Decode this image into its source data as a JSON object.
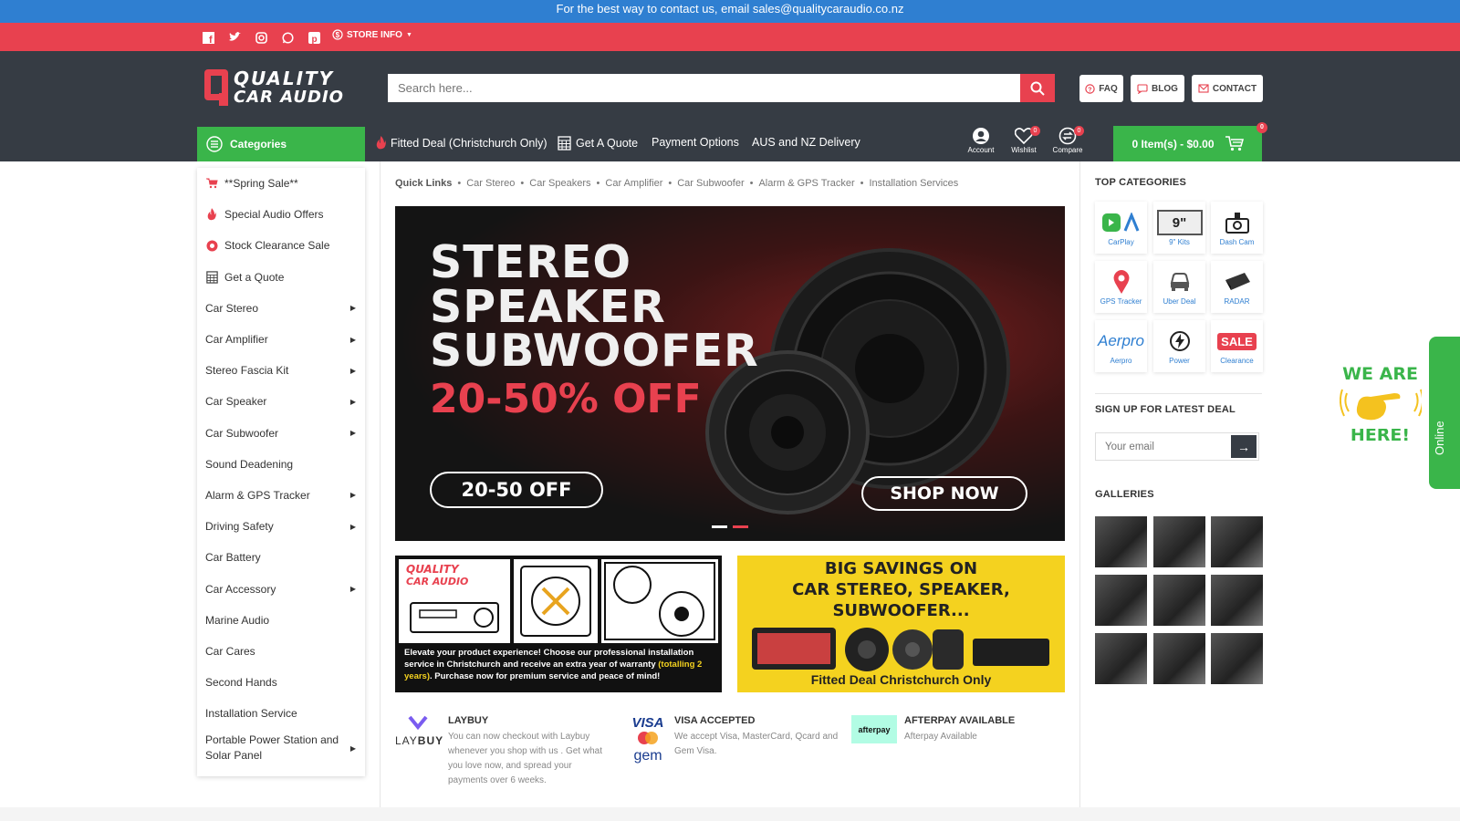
{
  "top_bar": {
    "message": "For the best way to contact us, email sales@qualitycaraudio.co.nz"
  },
  "social": {
    "icons": [
      "facebook-icon",
      "twitter-icon",
      "instagram-icon",
      "whatsapp-icon",
      "pinterest-icon"
    ],
    "store_info": "STORE INFO"
  },
  "header": {
    "logo_line1": "QUALITY",
    "logo_line2": "CAR AUDIO",
    "search_placeholder": "Search here...",
    "buttons": {
      "faq": "FAQ",
      "blog": "BLOG",
      "contact": "CONTACT"
    }
  },
  "nav": {
    "categories_label": "Categories",
    "links": [
      "Fitted Deal (Christchurch Only)",
      "Get A Quote",
      "Payment Options",
      "AUS and NZ Delivery"
    ],
    "account": "Account",
    "wishlist": "Wishlist",
    "wishlist_count": "0",
    "compare": "Compare",
    "compare_count": "0",
    "cart": "0 Item(s) - $0.00",
    "cart_count": "0"
  },
  "sidebar": {
    "items": [
      {
        "label": "**Spring Sale**",
        "icon": "cart-icon",
        "arrow": false
      },
      {
        "label": "Special Audio Offers",
        "icon": "flame-icon",
        "arrow": false
      },
      {
        "label": "Stock Clearance Sale",
        "icon": "clearance-icon",
        "arrow": false
      },
      {
        "label": "Get a Quote",
        "icon": "calculator-icon",
        "arrow": false
      },
      {
        "label": "Car Stereo",
        "arrow": true
      },
      {
        "label": "Car Amplifier",
        "arrow": true
      },
      {
        "label": "Stereo Fascia Kit",
        "arrow": true
      },
      {
        "label": "Car Speaker",
        "arrow": true
      },
      {
        "label": "Car Subwoofer",
        "arrow": true
      },
      {
        "label": "Sound Deadening",
        "arrow": false
      },
      {
        "label": "Alarm & GPS Tracker",
        "arrow": true
      },
      {
        "label": "Driving Safety",
        "arrow": true
      },
      {
        "label": "Car Battery",
        "arrow": false
      },
      {
        "label": "Car Accessory",
        "arrow": true
      },
      {
        "label": "Marine Audio",
        "arrow": false
      },
      {
        "label": "Car Cares",
        "arrow": false
      },
      {
        "label": "Second Hands",
        "arrow": false
      },
      {
        "label": "Installation Service",
        "arrow": false
      },
      {
        "label": "Portable Power Station and Solar Panel",
        "arrow": true
      }
    ]
  },
  "quick_links": {
    "label": "Quick Links",
    "links": [
      "Car Stereo",
      "Car Speakers",
      "Car Amplifier",
      "Car Subwoofer",
      "Alarm & GPS Tracker",
      "Installation Services"
    ]
  },
  "hero": {
    "line1": "STEREO",
    "line2": "SPEAKER",
    "line3": "SUBWOOFER",
    "discount": "20-50% OFF",
    "badge": "20-50 OFF",
    "cta": "SHOP NOW"
  },
  "promo_left": {
    "logo_line1": "QUALITY",
    "logo_line2": "CAR AUDIO",
    "text_part1": "Elevate your product experience! Choose our professional installation service in Christchurch and receive an extra year of warranty ",
    "text_highlight": "(totalling 2 years)",
    "text_part2": ". Purchase now for premium service and peace of mind!"
  },
  "promo_right": {
    "title1": "BIG SAVINGS ON",
    "title2": "CAR STEREO, SPEAKER,",
    "title3": "SUBWOOFER...",
    "footer": "Fitted Deal Christchurch Only"
  },
  "payments": [
    {
      "logo1": "LAY",
      "logo2": "BUY",
      "title": "LAYBUY",
      "desc": "You can now checkout with Laybuy whenever you shop with us . Get what you love now, and spread your payments over 6 weeks."
    },
    {
      "logo1": "VISA",
      "logo2": "gem",
      "title": "VISA ACCEPTED",
      "desc": "We accept Visa, MasterCard, Qcard and Gem Visa."
    },
    {
      "logo1": "afterpay",
      "title": "AFTERPAY AVAILABLE",
      "desc": "Afterpay Available"
    }
  ],
  "right": {
    "top_categories_title": "TOP CATEGORIES",
    "top_categories": [
      {
        "label": "CarPlay"
      },
      {
        "label": "9\" Kits",
        "mark": "9\""
      },
      {
        "label": "Dash Cam"
      },
      {
        "label": "GPS Tracker"
      },
      {
        "label": "Uber Deal"
      },
      {
        "label": "RADAR"
      },
      {
        "label": "Aerpro",
        "mark": "Aerpro"
      },
      {
        "label": "Power"
      },
      {
        "label": "Clearance",
        "mark": "SALE"
      }
    ],
    "signup_title": "SIGN UP FOR LATEST DEAL",
    "email_placeholder": "Your email",
    "galleries_title": "GALLERIES"
  },
  "chat": {
    "weare1": "WE ARE",
    "weare2": "HERE!",
    "online": "Online"
  },
  "colors": {
    "blue": "#2f7fd1",
    "red": "#e8414f",
    "green": "#3ab54a",
    "dark": "#363c44"
  }
}
